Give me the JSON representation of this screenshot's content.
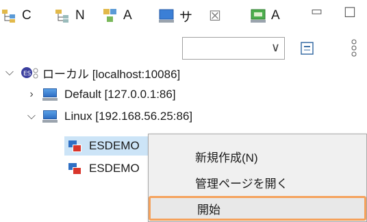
{
  "tabs": [
    {
      "label": "C",
      "icon": "class-hierarchy-icon"
    },
    {
      "label": "N",
      "icon": "navigator-icon"
    },
    {
      "label": "A",
      "icon": "apps-icon"
    },
    {
      "label": "サ",
      "icon": "server-view-icon",
      "close": "☒"
    },
    {
      "label": "A",
      "icon": "monitor-icon"
    }
  ],
  "window_controls": {
    "minimize": "▭",
    "maximize": "☐"
  },
  "toolbar": {
    "combo_value": "",
    "combo_arrow": "∨"
  },
  "tree": {
    "root": {
      "label": "ローカル [localhost:10086]",
      "expanded": true
    },
    "default_server": {
      "label": "Default [127.0.0.1:86]",
      "expanded": false
    },
    "linux_server": {
      "label": "Linux [192.168.56.25:86]",
      "expanded": true
    },
    "apps": [
      {
        "label": "ESDEMO",
        "selected": true
      },
      {
        "label": "ESDEMO",
        "selected": false
      }
    ]
  },
  "context_menu": {
    "items": [
      {
        "label": "新規作成(N)"
      },
      {
        "label": "管理ページを開く"
      },
      {
        "label": "開始",
        "highlighted": true
      }
    ]
  },
  "colors": {
    "accent_highlight": "#f5a15b",
    "selection": "#cce4f7",
    "server_blue": "#2f6fc4"
  }
}
